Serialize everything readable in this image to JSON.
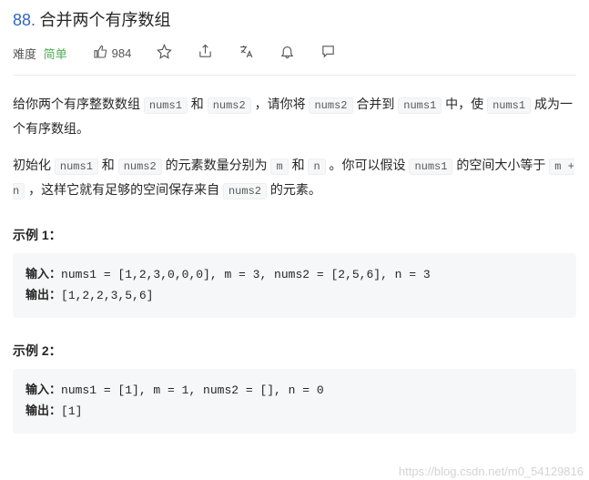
{
  "problem": {
    "number": "88.",
    "title": "合并两个有序数组"
  },
  "meta": {
    "difficulty_label": "难度",
    "difficulty_value": "简单",
    "likes_count": "984"
  },
  "description": {
    "p1_a": "给你两个有序整数数组 ",
    "p1_code1": "nums1",
    "p1_b": " 和 ",
    "p1_code2": "nums2",
    "p1_c": " ，请你将 ",
    "p1_code3": "nums2",
    "p1_d": " 合并到 ",
    "p1_code4": "nums1",
    "p1_e": " 中，使 ",
    "p1_code5": "nums1",
    "p1_f": " 成为一个有序数组。",
    "p2_a": "初始化 ",
    "p2_code1": "nums1",
    "p2_b": " 和 ",
    "p2_code2": "nums2",
    "p2_c": " 的元素数量分别为 ",
    "p2_code3": "m",
    "p2_d": " 和 ",
    "p2_code4": "n",
    "p2_e": " 。你可以假设 ",
    "p2_code5": "nums1",
    "p2_f": " 的空间大小等于 ",
    "p2_code6": "m + n",
    "p2_g": " ，这样它就有足够的空间保存来自 ",
    "p2_code7": "nums2",
    "p2_h": " 的元素。"
  },
  "examples": {
    "ex1_heading": "示例 1：",
    "ex1_input_label": "输入：",
    "ex1_input_value": "nums1 = [1,2,3,0,0,0], m = 3, nums2 = [2,5,6], n = 3",
    "ex1_output_label": "输出：",
    "ex1_output_value": "[1,2,2,3,5,6]",
    "ex2_heading": "示例 2：",
    "ex2_input_label": "输入：",
    "ex2_input_value": "nums1 = [1], m = 1, nums2 = [], n = 0",
    "ex2_output_label": "输出：",
    "ex2_output_value": "[1]"
  },
  "watermark": "https://blog.csdn.net/m0_54129816"
}
